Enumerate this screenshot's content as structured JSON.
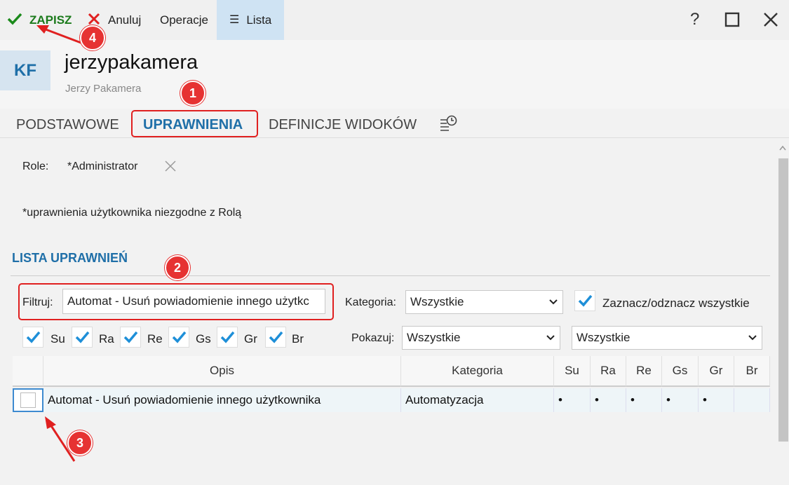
{
  "toolbar": {
    "save_label": "ZAPISZ",
    "cancel_label": "Anuluj",
    "operations_label": "Operacje",
    "list_label": "Lista",
    "help": "?",
    "close": "✕"
  },
  "user": {
    "initials": "KF",
    "login": "jerzypakamera",
    "full_name": "Jerzy Pakamera"
  },
  "tabs": [
    {
      "label": "PODSTAWOWE"
    },
    {
      "label": "UPRAWNIENIA"
    },
    {
      "label": "DEFINICJE WIDOKÓW"
    }
  ],
  "roles": {
    "label": "Role:",
    "value": "*Administrator",
    "note": "*uprawnienia użytkownika niezgodne z Rolą"
  },
  "permissions": {
    "section_title": "LISTA UPRAWNIEŃ",
    "filter_label": "Filtruj:",
    "filter_value": "Automat - Usuń powiadomienie innego użytkc",
    "category_label": "Kategoria:",
    "category_value": "Wszystkie",
    "select_all_label": "Zaznacz/odznacz wszystkie",
    "show_label": "Pokazuj:",
    "show_value": "Wszystkie",
    "show_value2": "Wszystkie",
    "flags": [
      "Su",
      "Ra",
      "Re",
      "Gs",
      "Gr",
      "Br"
    ]
  },
  "table": {
    "headers": [
      "Opis",
      "Kategoria",
      "Su",
      "Ra",
      "Re",
      "Gs",
      "Gr",
      "Br"
    ],
    "rows": [
      {
        "opis": "Automat - Usuń powiadomienie innego użytkownika",
        "kategoria": "Automatyzacja",
        "su": "•",
        "ra": "•",
        "re": "•",
        "gs": "•",
        "gr": "•",
        "br": ""
      }
    ]
  },
  "annotations": [
    "1",
    "2",
    "3",
    "4"
  ],
  "colors": {
    "accent": "#1f6fa8",
    "save_green": "#1b7a1b",
    "annotation_red": "#e02020"
  }
}
